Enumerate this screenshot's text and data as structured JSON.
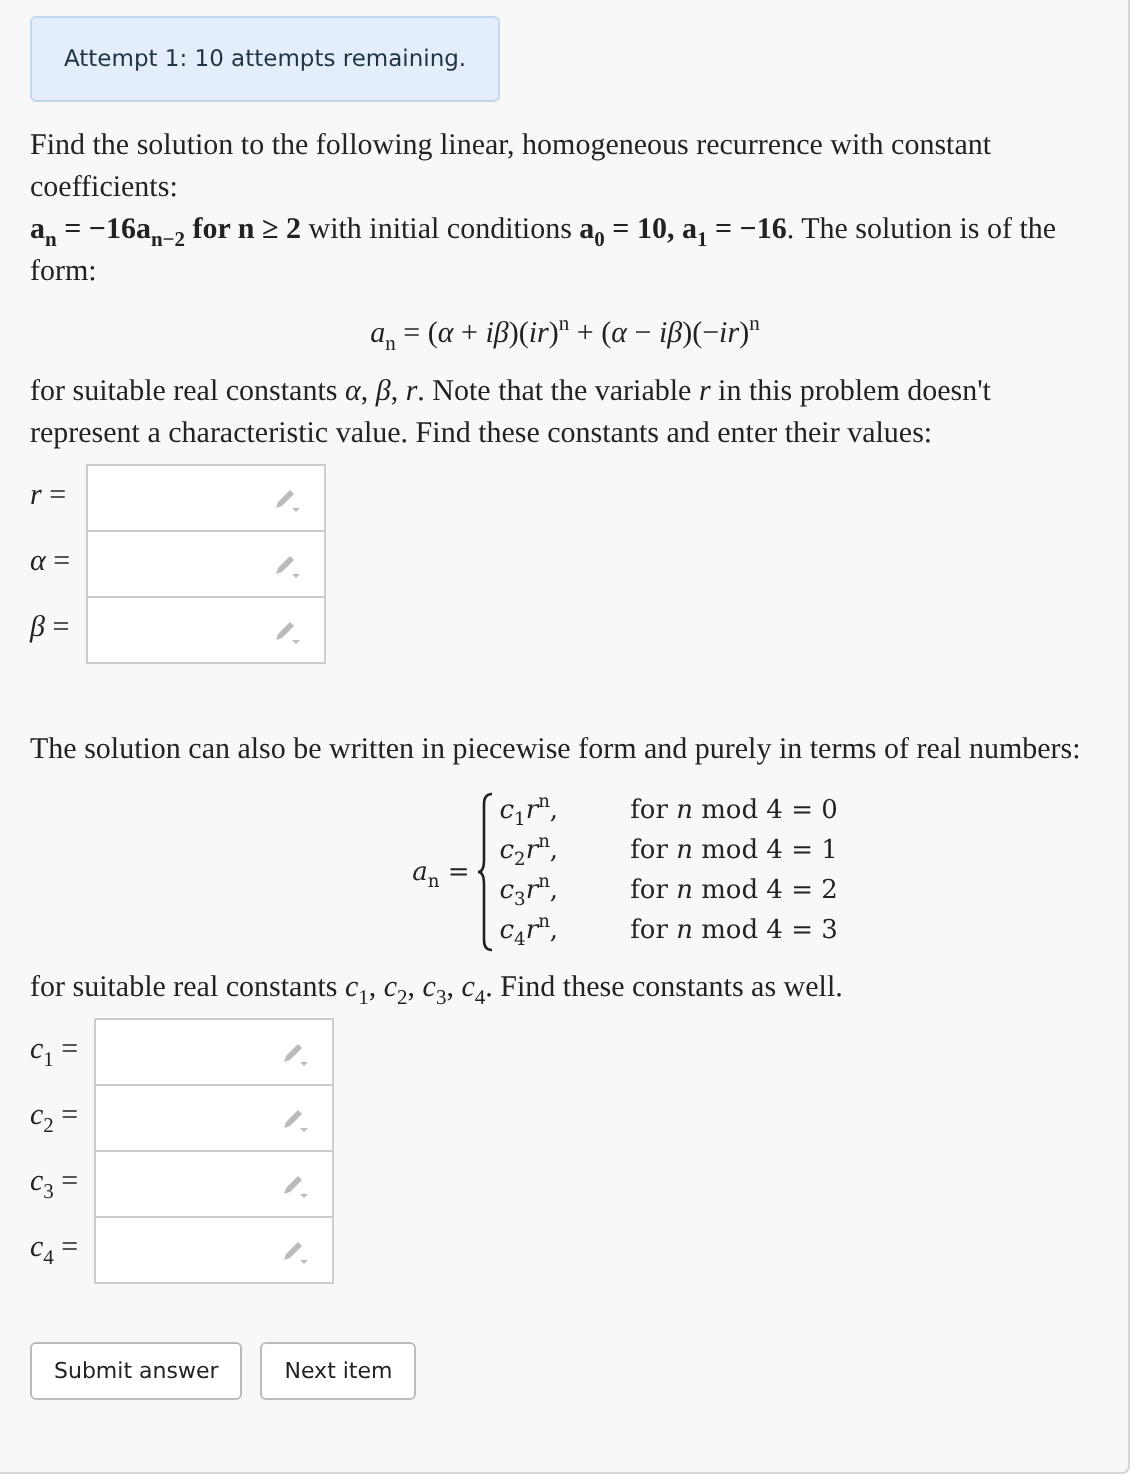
{
  "attempt_notice": "Attempt 1: 10 attempts remaining.",
  "intro": "Find the solution to the following linear, homogeneous recurrence with constant coefficients:",
  "recurrence": "**a$_{n}$ = −16a$_{n−2}$ for n ≥ 2** with initial conditions **a$_{0}$ = 10, a$_{1}$ = −16**. The solution is of the form:",
  "solution_form": "*a*$_{n}$ = (*α* + *iβ*)(*ir*)$^{n}$ + (*α* − *iβ*)(−*ir*)$^{n}$",
  "constants_text": "for suitable real constants *α*, *β*, *r*. Note that the variable *r* in this problem doesn't represent a characteristic value. Find these constants and enter their values:",
  "fields_1": [
    {
      "label": "*r* ="
    },
    {
      "label": "*α* ="
    },
    {
      "label": "*β* ="
    }
  ],
  "piecewise_text": "The solution can also be written in piecewise form and purely in terms of real numbers:",
  "piecewise": {
    "lhs": "*a*$_{n}$ =",
    "cases": [
      {
        "expr": "*c*$_{1}$*r*$^{n}$,",
        "condition": "for *n* mod 4 = 0"
      },
      {
        "expr": "*c*$_{2}$*r*$^{n}$,",
        "condition": "for *n* mod 4 = 1"
      },
      {
        "expr": "*c*$_{3}$*r*$^{n}$,",
        "condition": "for *n* mod 4 = 2"
      },
      {
        "expr": "*c*$_{4}$*r*$^{n}$,",
        "condition": "for *n* mod 4 = 3"
      }
    ]
  },
  "constants_text_2": "for suitable real constants *c*$_{1}$, *c*$_{2}$, *c*$_{3}$, *c*$_{4}$. Find these constants as well.",
  "fields_2": [
    {
      "label": "*c*$_{1}$ ="
    },
    {
      "label": "*c*$_{2}$ ="
    },
    {
      "label": "*c*$_{3}$ ="
    },
    {
      "label": "*c*$_{4}$ ="
    }
  ],
  "buttons": [
    "Submit answer",
    "Next item"
  ]
}
